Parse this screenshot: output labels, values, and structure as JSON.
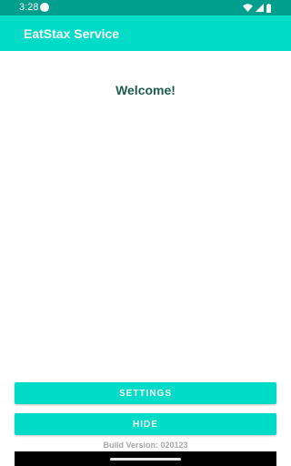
{
  "status_bar": {
    "time": "3:28",
    "icons": [
      "notification-dot-icon",
      "wifi-icon",
      "cellular-signal-icon",
      "battery-icon"
    ]
  },
  "app_bar": {
    "title": "EatStax Service"
  },
  "main": {
    "welcome_text": "Welcome!"
  },
  "actions": {
    "settings_label": "SETTINGS",
    "hide_label": "HIDE"
  },
  "footer": {
    "build_version": "Build Version: 020123"
  },
  "colors": {
    "accent": "#00dcc8",
    "status_bar": "#009e8c",
    "welcome_text": "#1f5c50",
    "build_text": "#a8a8a8"
  }
}
